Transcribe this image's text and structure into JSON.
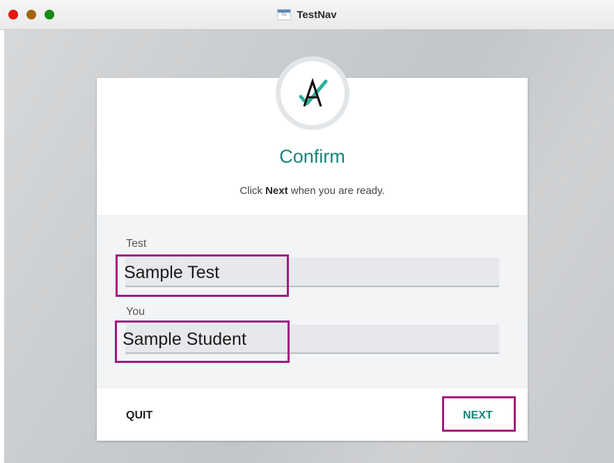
{
  "window": {
    "title": "TestNav"
  },
  "dialog": {
    "heading": "Confirm",
    "instruction_prefix": "Click ",
    "instruction_bold": "Next",
    "instruction_suffix": " when you are ready."
  },
  "fields": {
    "test": {
      "label": "Test",
      "value": "Sample Test"
    },
    "you": {
      "label": "You",
      "value": "Sample Student"
    }
  },
  "buttons": {
    "quit": "QUIT",
    "next": "NEXT"
  },
  "icons": {
    "app": "testnav-app-icon",
    "logo": "pearson-a-check-logo"
  },
  "colors": {
    "accent": "#17857a",
    "highlight": "#a3187d",
    "close": "#e8150e",
    "minimize": "#a3650b",
    "maximize": "#168a16"
  }
}
